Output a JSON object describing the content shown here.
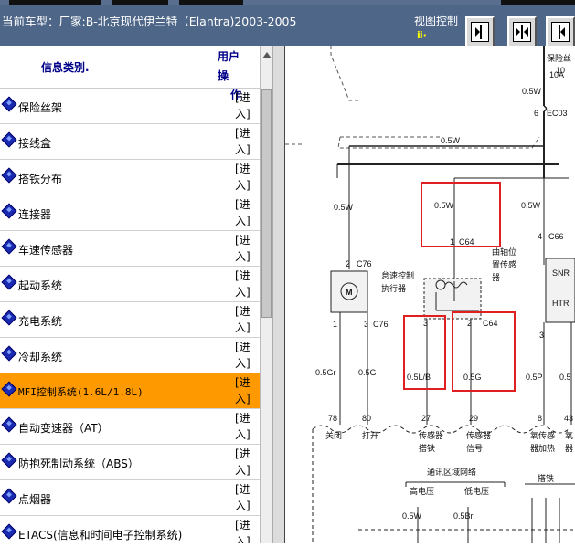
{
  "header": {
    "title": "当前车型：厂家:B-北京现代伊兰特（Elantra)2003-2005",
    "view_control_label": "视图控制",
    "view_control_mark": "ⅱ·"
  },
  "sidebar": {
    "col_category": "信息类别.",
    "col_action_line1": "用户操",
    "col_action_line2": "作",
    "action_line1": "[进",
    "action_line2": "入]",
    "items": [
      {
        "label": "保险丝架"
      },
      {
        "label": "接线盒"
      },
      {
        "label": "搭铁分布"
      },
      {
        "label": "连接器"
      },
      {
        "label": "车速传感器"
      },
      {
        "label": "起动系统"
      },
      {
        "label": "充电系统"
      },
      {
        "label": "冷却系统"
      },
      {
        "label": "MFI控制系统(1.6L/1.8L)"
      },
      {
        "label": "自动变速器（AT）"
      },
      {
        "label": "防抱死制动系统（ABS）"
      },
      {
        "label": "点烟器"
      },
      {
        "label": "ETACS(信息和时间电子控制系统)"
      }
    ]
  },
  "diagram": {
    "labels": {
      "fuse": "保险丝",
      "fuse_no": "10",
      "fuse_amp": "10A",
      "w05_top": "0.5W",
      "w05_mid": "0.5W",
      "w05_left": "0.5W",
      "w05_box": "0.5W",
      "w05_right": "0.5W",
      "ec03": "EC03",
      "pin6": "6",
      "c64_top": "C64",
      "pin1": "1",
      "c66": "C66",
      "pin4": "4",
      "c76_top": "C76",
      "c76_bot": "C76",
      "pin2": "2",
      "idle_ctrl": "怠速控制",
      "actuator": "执行器",
      "cam1": "曲轴位",
      "cam2": "置传感",
      "cam3": "器",
      "snr": "SNR",
      "htr": "HTR",
      "m": "M",
      "pin1b": "1",
      "pin3b": "3",
      "pin3c": "3",
      "pin2c": "2",
      "c64_bot": "C64",
      "pin3d": "3",
      "w_05gr": "0.5Gr",
      "w_05g": "0.5G",
      "w_05lb": "0.5L/B",
      "w_05g2": "0.5G",
      "w_05p": "0.5P",
      "w_05": "0.5",
      "t78": "78",
      "t80": "80",
      "t27": "27",
      "t29": "29",
      "t8": "8",
      "t43": "43",
      "close": "关闭",
      "open": "打开",
      "sensor_gnd1": "传感器",
      "sensor_gnd2": "搭铁",
      "sensor_sig1": "传感器",
      "sensor_sig2": "信号",
      "o2_heat1": "氧传感",
      "o2_heat2": "器加热",
      "o2_1": "氧",
      "o2_2": "器",
      "comm": "通讯区域网络",
      "high_v": "高电压",
      "low_v": "低电压",
      "gnd": "搭铁",
      "w_bottom1": "0.5W",
      "w_bottom2": "0.5Br"
    }
  },
  "colors": {
    "header_bg": "#4e6688",
    "selected_row": "#ff9900",
    "highlight_box": "#e02020"
  }
}
